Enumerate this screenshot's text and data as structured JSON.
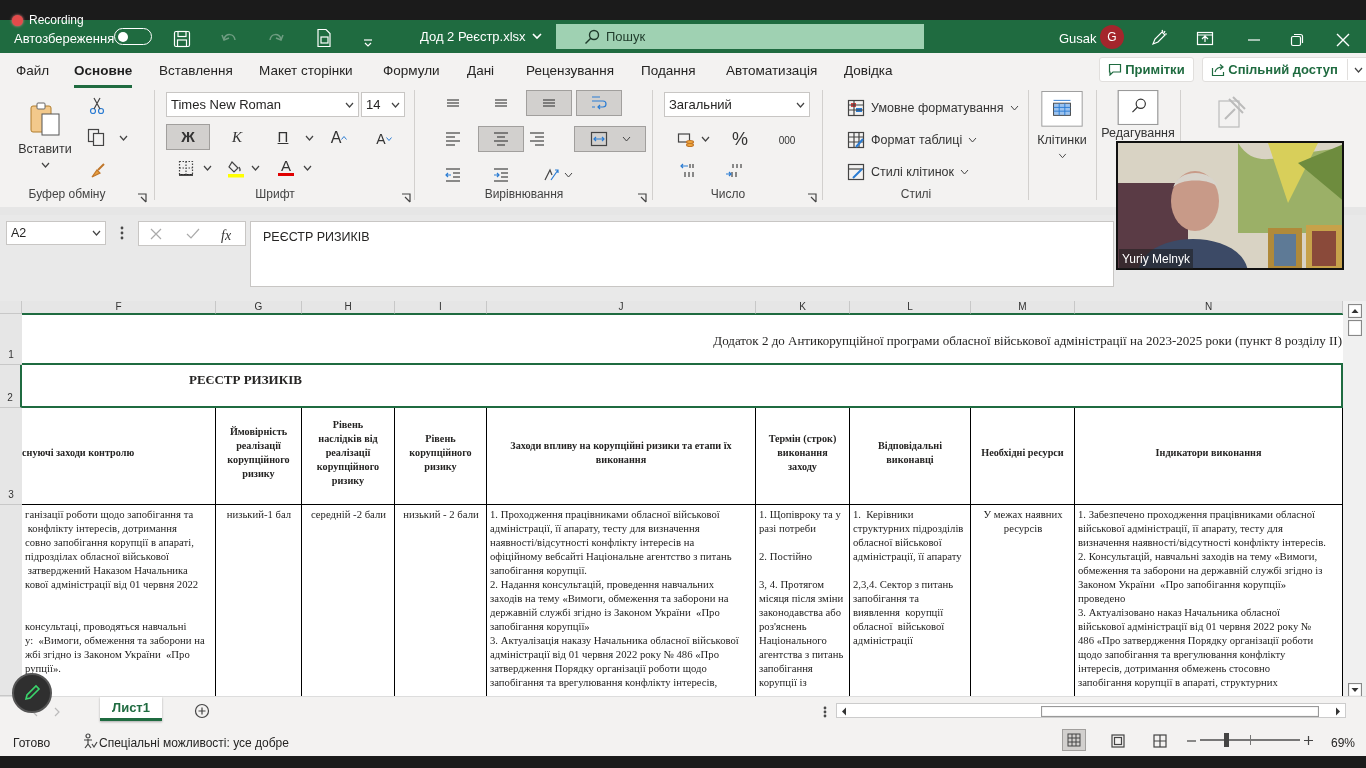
{
  "recording": {
    "label": "Recording"
  },
  "title_bar": {
    "autosave_label": "Автозбереження",
    "autosave_on": false,
    "file_name": "Дод 2 Реєстр.xlsx",
    "search_placeholder": "Пошук",
    "user_name": "Gusak",
    "user_initial": "G"
  },
  "ribbon_tabs": [
    {
      "label": "Файл",
      "selected": false
    },
    {
      "label": "Основне",
      "selected": true
    },
    {
      "label": "Вставлення",
      "selected": false
    },
    {
      "label": "Макет сторінки",
      "selected": false
    },
    {
      "label": "Формули",
      "selected": false
    },
    {
      "label": "Дані",
      "selected": false
    },
    {
      "label": "Рецензування",
      "selected": false
    },
    {
      "label": "Подання",
      "selected": false
    },
    {
      "label": "Автоматизація",
      "selected": false
    },
    {
      "label": "Довідка",
      "selected": false
    }
  ],
  "ribbon_actions": [
    {
      "kind": "comments",
      "label": "Примітки"
    },
    {
      "kind": "share",
      "label": "Спільний доступ"
    }
  ],
  "ribbon": {
    "clipboard": {
      "paste_label": "Вставити",
      "group_label": "Буфер обміну"
    },
    "font": {
      "font_name": "Times New Roman",
      "font_size": "14",
      "bold": {
        "label": "Ж",
        "selected": true
      },
      "italic": {
        "label": "К",
        "selected": false
      },
      "underline": {
        "label": "П",
        "selected": false
      },
      "grow_label": "A",
      "shrink_label": "A",
      "color_label": "A",
      "group_label": "Шрифт"
    },
    "alignment": {
      "buttons": [
        {
          "kind": "align-top",
          "selected": false
        },
        {
          "kind": "align-middle",
          "selected": false
        },
        {
          "kind": "align-bottom",
          "selected": true
        },
        {
          "kind": "wrap",
          "selected": true
        },
        {
          "kind": "align-left",
          "selected": false
        },
        {
          "kind": "align-center",
          "selected": true
        },
        {
          "kind": "align-right",
          "selected": false
        },
        {
          "kind": "merge",
          "selected": true
        },
        {
          "kind": "outdent",
          "selected": false
        },
        {
          "kind": "indent",
          "selected": false
        },
        {
          "kind": "orientation",
          "selected": false
        }
      ],
      "group_label": "Вирівнювання"
    },
    "number": {
      "format": "Загальний",
      "percent": "%",
      "thousands": "000",
      "group_label": "Число"
    },
    "styles": {
      "items": [
        "Умовне форматування",
        "Формат таблиці",
        "Стилі клітинок"
      ],
      "group_label": "Стилі"
    },
    "cells": {
      "label": "Клітинки"
    },
    "editing": {
      "label": "Редагування"
    }
  },
  "formula_bar": {
    "name_box": "A2",
    "fx": "fx",
    "formula": "РЕЄСТР РИЗИКІВ"
  },
  "sheet": {
    "columns": [
      "F",
      "G",
      "H",
      "I",
      "J",
      "K",
      "L",
      "M",
      "N"
    ],
    "row_numbers": [
      "1",
      "2",
      "3"
    ],
    "note": "Додаток 2 до Антикорупційної програми обласної військової адміністрації на 2023-2025 роки (пункт 8 розділу ІІ)",
    "title": "РЕЄСТР РИЗИКІВ",
    "headers": [
      "снуючі заходи контролю",
      "Ймовірність\nреалізації\nкорупційного\nризику",
      "Рівень\nнаслідків від\nреалізації\nкорупційного\nризику",
      "Рівень\nкорупційного\nризику",
      "Заходи впливу на корупційні ризики та етапи їх\nвиконання",
      "Термін (строк)\nвиконання\nзаходу",
      "Відповідальні\nвиконавці",
      "Необхідні ресурси",
      "Індикатори виконання"
    ],
    "rows": [
      [
        "ганізації роботи щодо запобігання та\n конфлікту інтересів, дотримання\nсовно запобігання корупції в апараті,\nпідрозділах обласної військової\n затверджений Наказом Начальника\nкової адміністрації від 01 червня 2022\n\n\nконсультаці, проводяться навчальні\nу:  «Вимоги, обмеження та заборони на\nжбі згідно із Законом України  «Про\nрупції».",
        "низький-1 бал",
        "середній -2 бали",
        "низький - 2 бали",
        "1. Проходження працівниками обласної військової\nадміністрації, її апарату, тесту для визначення\nнаявності/відсутності конфлікту інтересів на\nофіційному вебсайті Національне агентство з питань\nзапобігання корупції.\n2. Надання консультацій, проведення навчальних\nзаходів на тему «Вимоги, обмеження та заборони на\nдержавній службі згідно із Законом України  «Про\nзапобігання корупції»\n3. Актуалізація наказу Начальника обласної військової\nадміністрації від 01 червня 2022 року № 486 «Про\nзатвердження Порядку організації роботи щодо\nзапобігання та врегулювання конфлікту інтересів,",
        "1. Щопівроку та у\nразі потреби\n\n2. Постійно\n\n3, 4. Протягом\nмісяця після зміни\nзаконодавства або\nроз'яснень\nНаціонального\nагентства з питань\nзапобігання\nкорупції із",
        "1.  Керівники\nструктурних підрозділів\nобласної військової\nадміністрації, її апарату\n\n2,3,4. Сектор з питань\nзапобігання та\nвиявлення  корупції\nобласної  військової\nадміністрації",
        "У межах наявних\nресурсів",
        "1. Забезпечено проходження працівниками обласної\nвійськової адміністрації, її апарату, тесту для\nвизначення наявності/відсутності конфлікту інтересів.\n2. Консультацій, навчальні заходів на тему «Вимоги,\nобмеження та заборони на державній службі згідно із\nЗаконом України  «Про запобігання корупції»\nпроведено\n3. Актуалізовано наказ Начальника обласної\nвійськової адміністрації від 01 червня 2022 року №\n486 «Про затвердження Порядку організації роботи\nщодо запобігання та врегулювання конфлікту\nінтересів, дотримання обмежень стосовно\nзапобігання корупції в апараті, структурних"
      ]
    ]
  },
  "sheet_tabs": [
    {
      "label": "Лист1",
      "selected": true
    }
  ],
  "status_bar": {
    "ready": "Готово",
    "accessibility": "Спеціальні можливості: усе добре",
    "zoom": "69%",
    "zoom_slider": {
      "level": 0.26
    }
  },
  "video": {
    "name": "Yuriy Melnyk"
  }
}
